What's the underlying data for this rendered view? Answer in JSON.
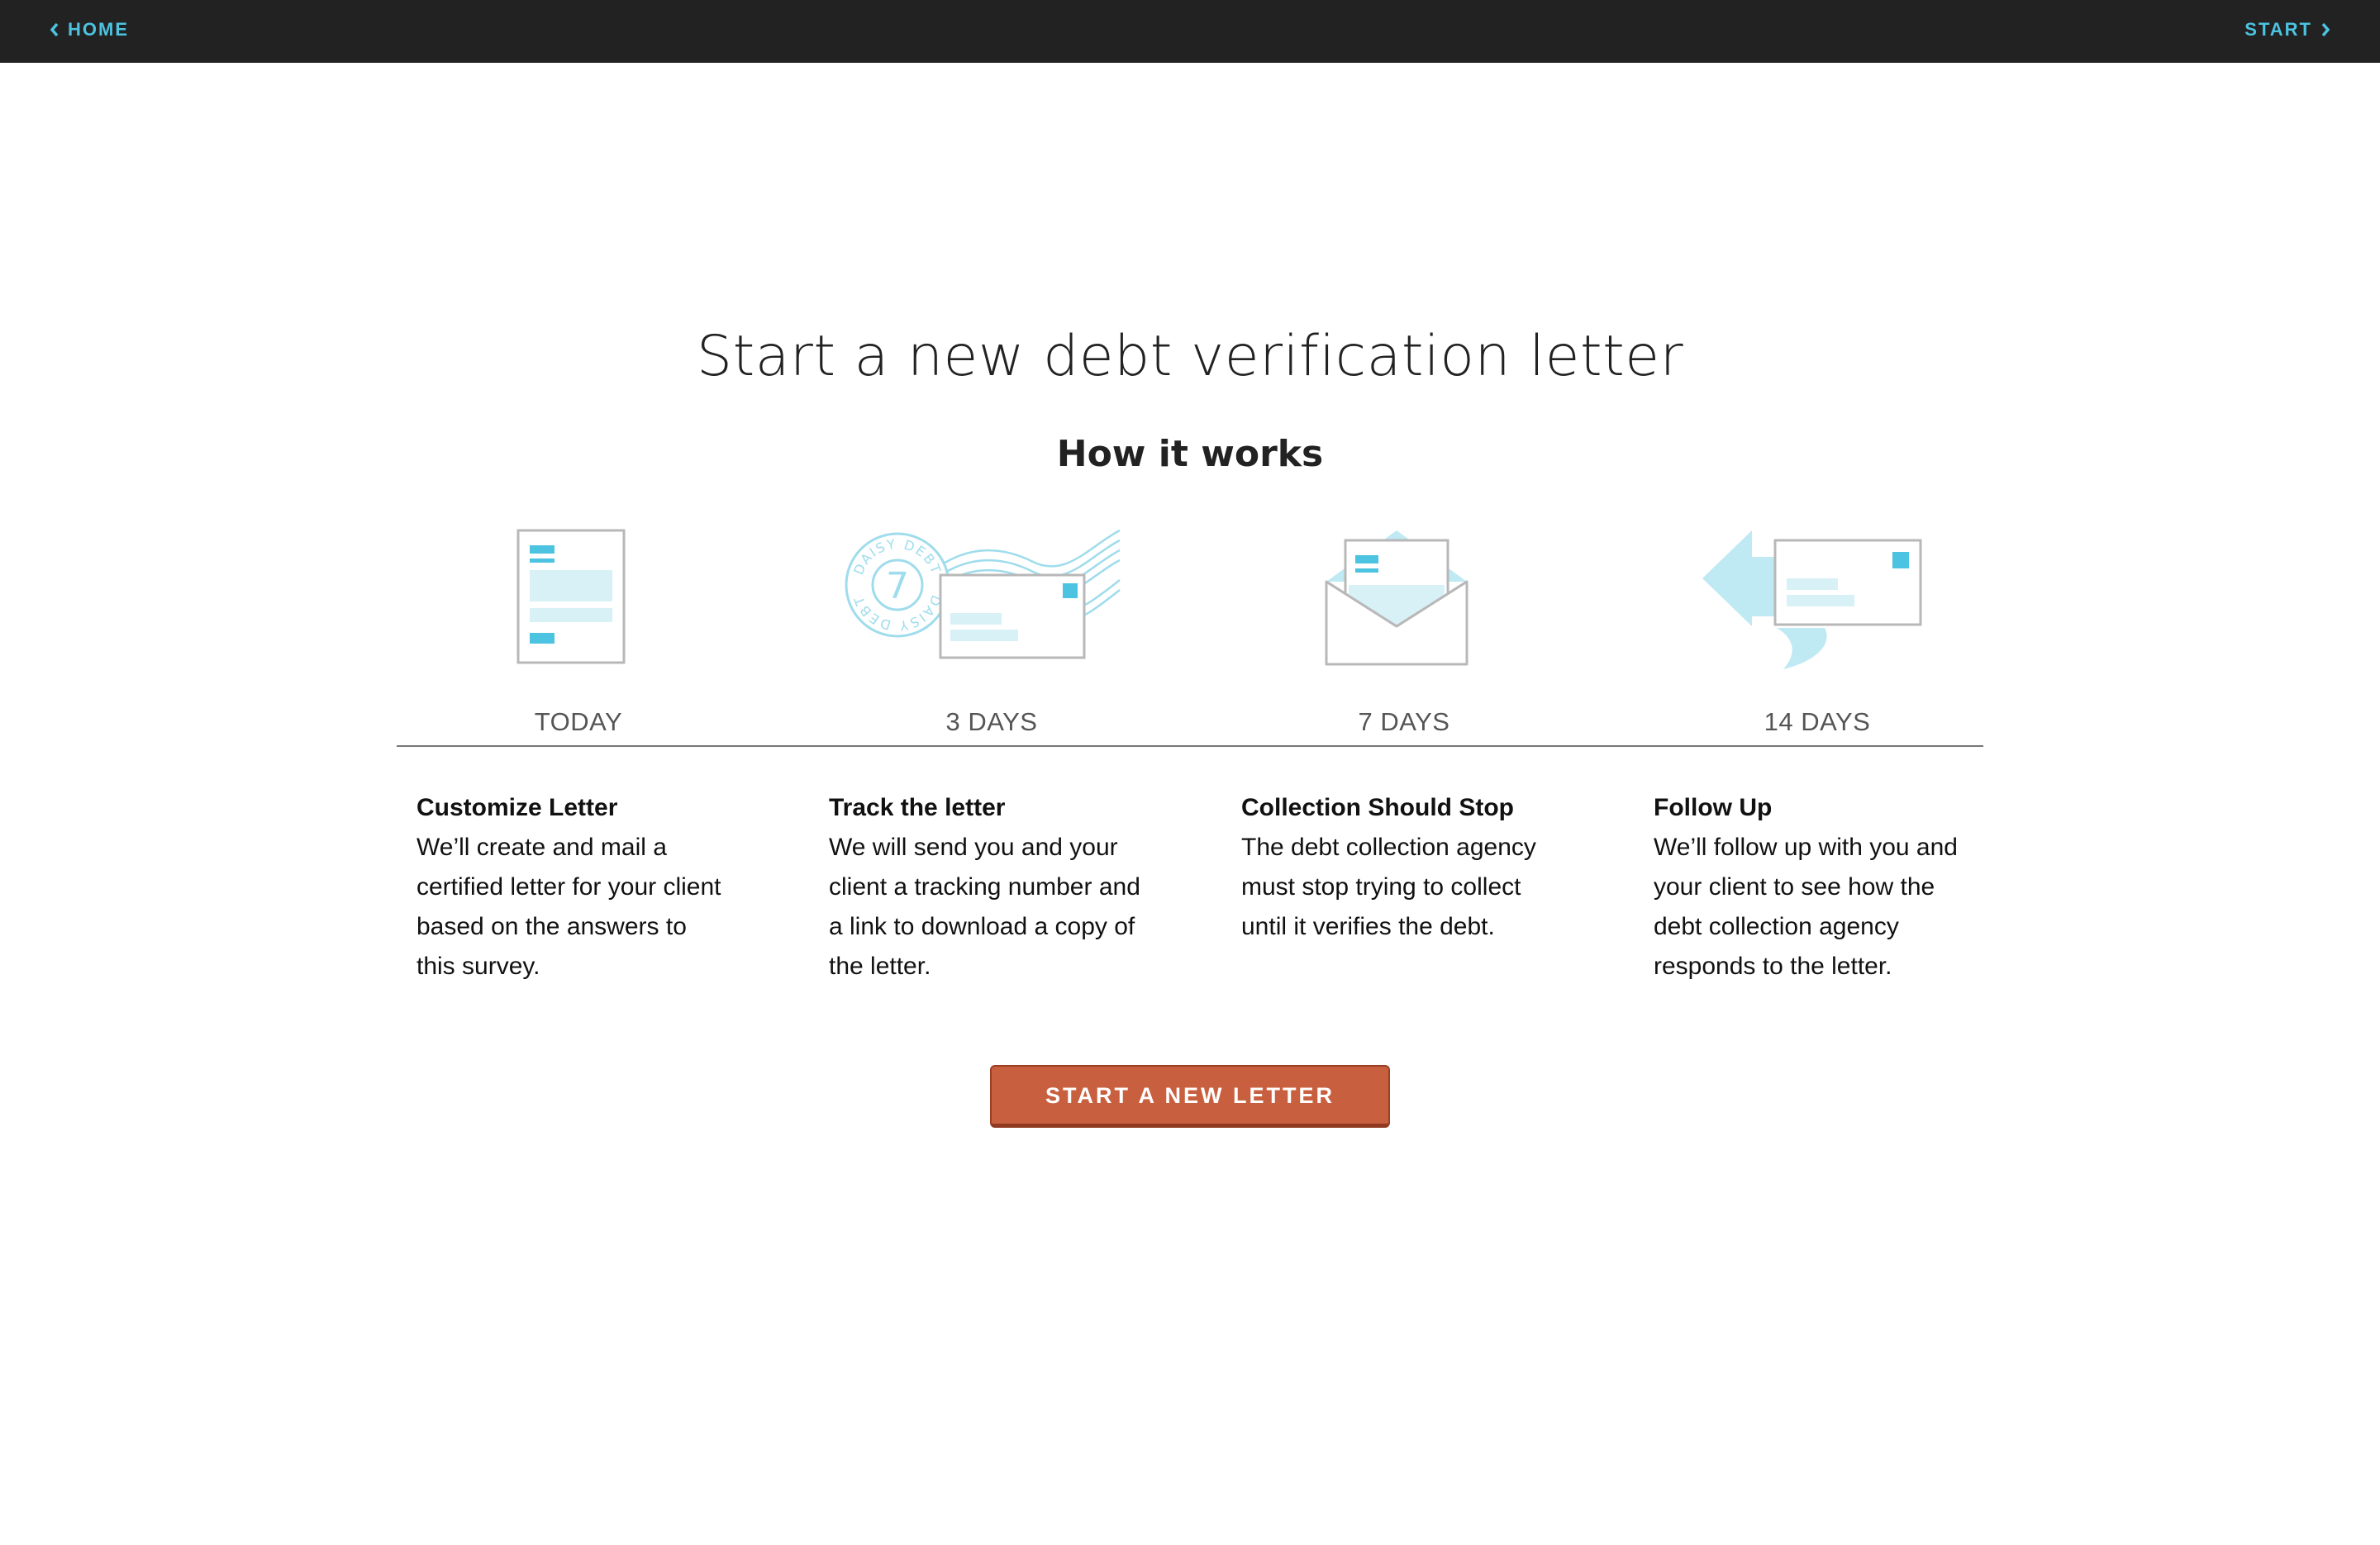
{
  "nav": {
    "home_label": "HOME",
    "start_label": "START"
  },
  "header": {
    "title": "Start a new debt verification letter",
    "subtitle": "How it works"
  },
  "steps": [
    {
      "time": "TODAY",
      "heading": "Customize Letter",
      "description": "We’ll create and mail a certified letter for your client based on the answers to this survey.",
      "icon": "document-icon"
    },
    {
      "time": "3 DAYS",
      "heading": "Track the letter",
      "description": "We will send you and your client a tracking number and a link to download a copy of the letter.",
      "icon": "postmark-envelope-icon",
      "stamp_text": "DAISY DEBT",
      "stamp_number": "7"
    },
    {
      "time": "7 DAYS",
      "heading": "Collection Should Stop",
      "description": "The debt collection agency must stop trying to collect until it verifies the debt.",
      "icon": "open-envelope-icon"
    },
    {
      "time": "14 DAYS",
      "heading": "Follow Up",
      "description": "We’ll follow up with you and your client to see how the debt collection agency responds to the letter.",
      "icon": "reply-envelope-icon"
    }
  ],
  "cta": {
    "label": "START A NEW LETTER"
  },
  "colors": {
    "topbar": "#222222",
    "accent_blue": "#4cc3e0",
    "light_blue": "#bfe9f3",
    "cta": "#c8603f",
    "icon_outline": "#b3b3b3"
  }
}
